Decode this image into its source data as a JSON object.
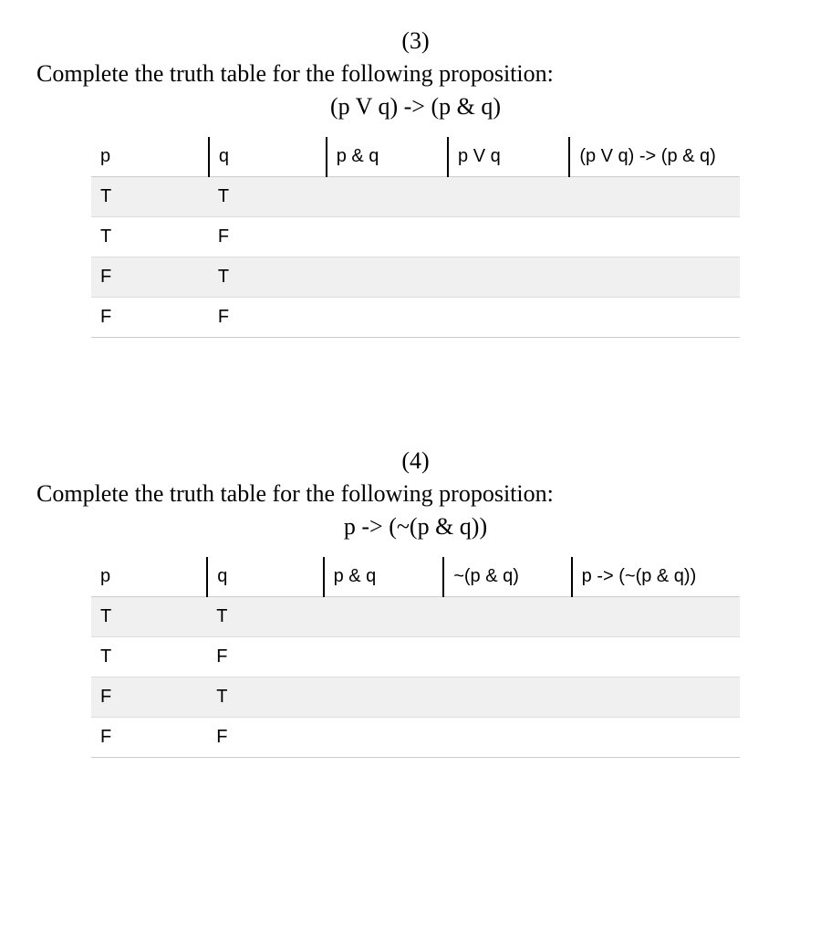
{
  "problems": [
    {
      "number": "(3)",
      "instruction": "Complete the truth table for the following proposition:",
      "proposition": "(p V q) -> (p & q)",
      "headers": [
        "p",
        "q",
        "p & q",
        "p V q",
        "(p V q) -> (p & q)"
      ],
      "rows": [
        {
          "cells": [
            "T",
            "T",
            "",
            "",
            ""
          ]
        },
        {
          "cells": [
            "T",
            "F",
            "",
            "",
            ""
          ]
        },
        {
          "cells": [
            "F",
            "T",
            "",
            "",
            ""
          ]
        },
        {
          "cells": [
            "F",
            "F",
            "",
            "",
            ""
          ]
        }
      ]
    },
    {
      "number": "(4)",
      "instruction": "Complete the truth table for the following proposition:",
      "proposition": "p -> (~(p & q))",
      "headers": [
        "p",
        "q",
        "p & q",
        "~(p & q)",
        "p -> (~(p & q))"
      ],
      "rows": [
        {
          "cells": [
            "T",
            "T",
            "",
            "",
            ""
          ]
        },
        {
          "cells": [
            "T",
            "F",
            "",
            "",
            ""
          ]
        },
        {
          "cells": [
            "F",
            "T",
            "",
            "",
            ""
          ]
        },
        {
          "cells": [
            "F",
            "F",
            "",
            "",
            ""
          ]
        }
      ]
    }
  ]
}
